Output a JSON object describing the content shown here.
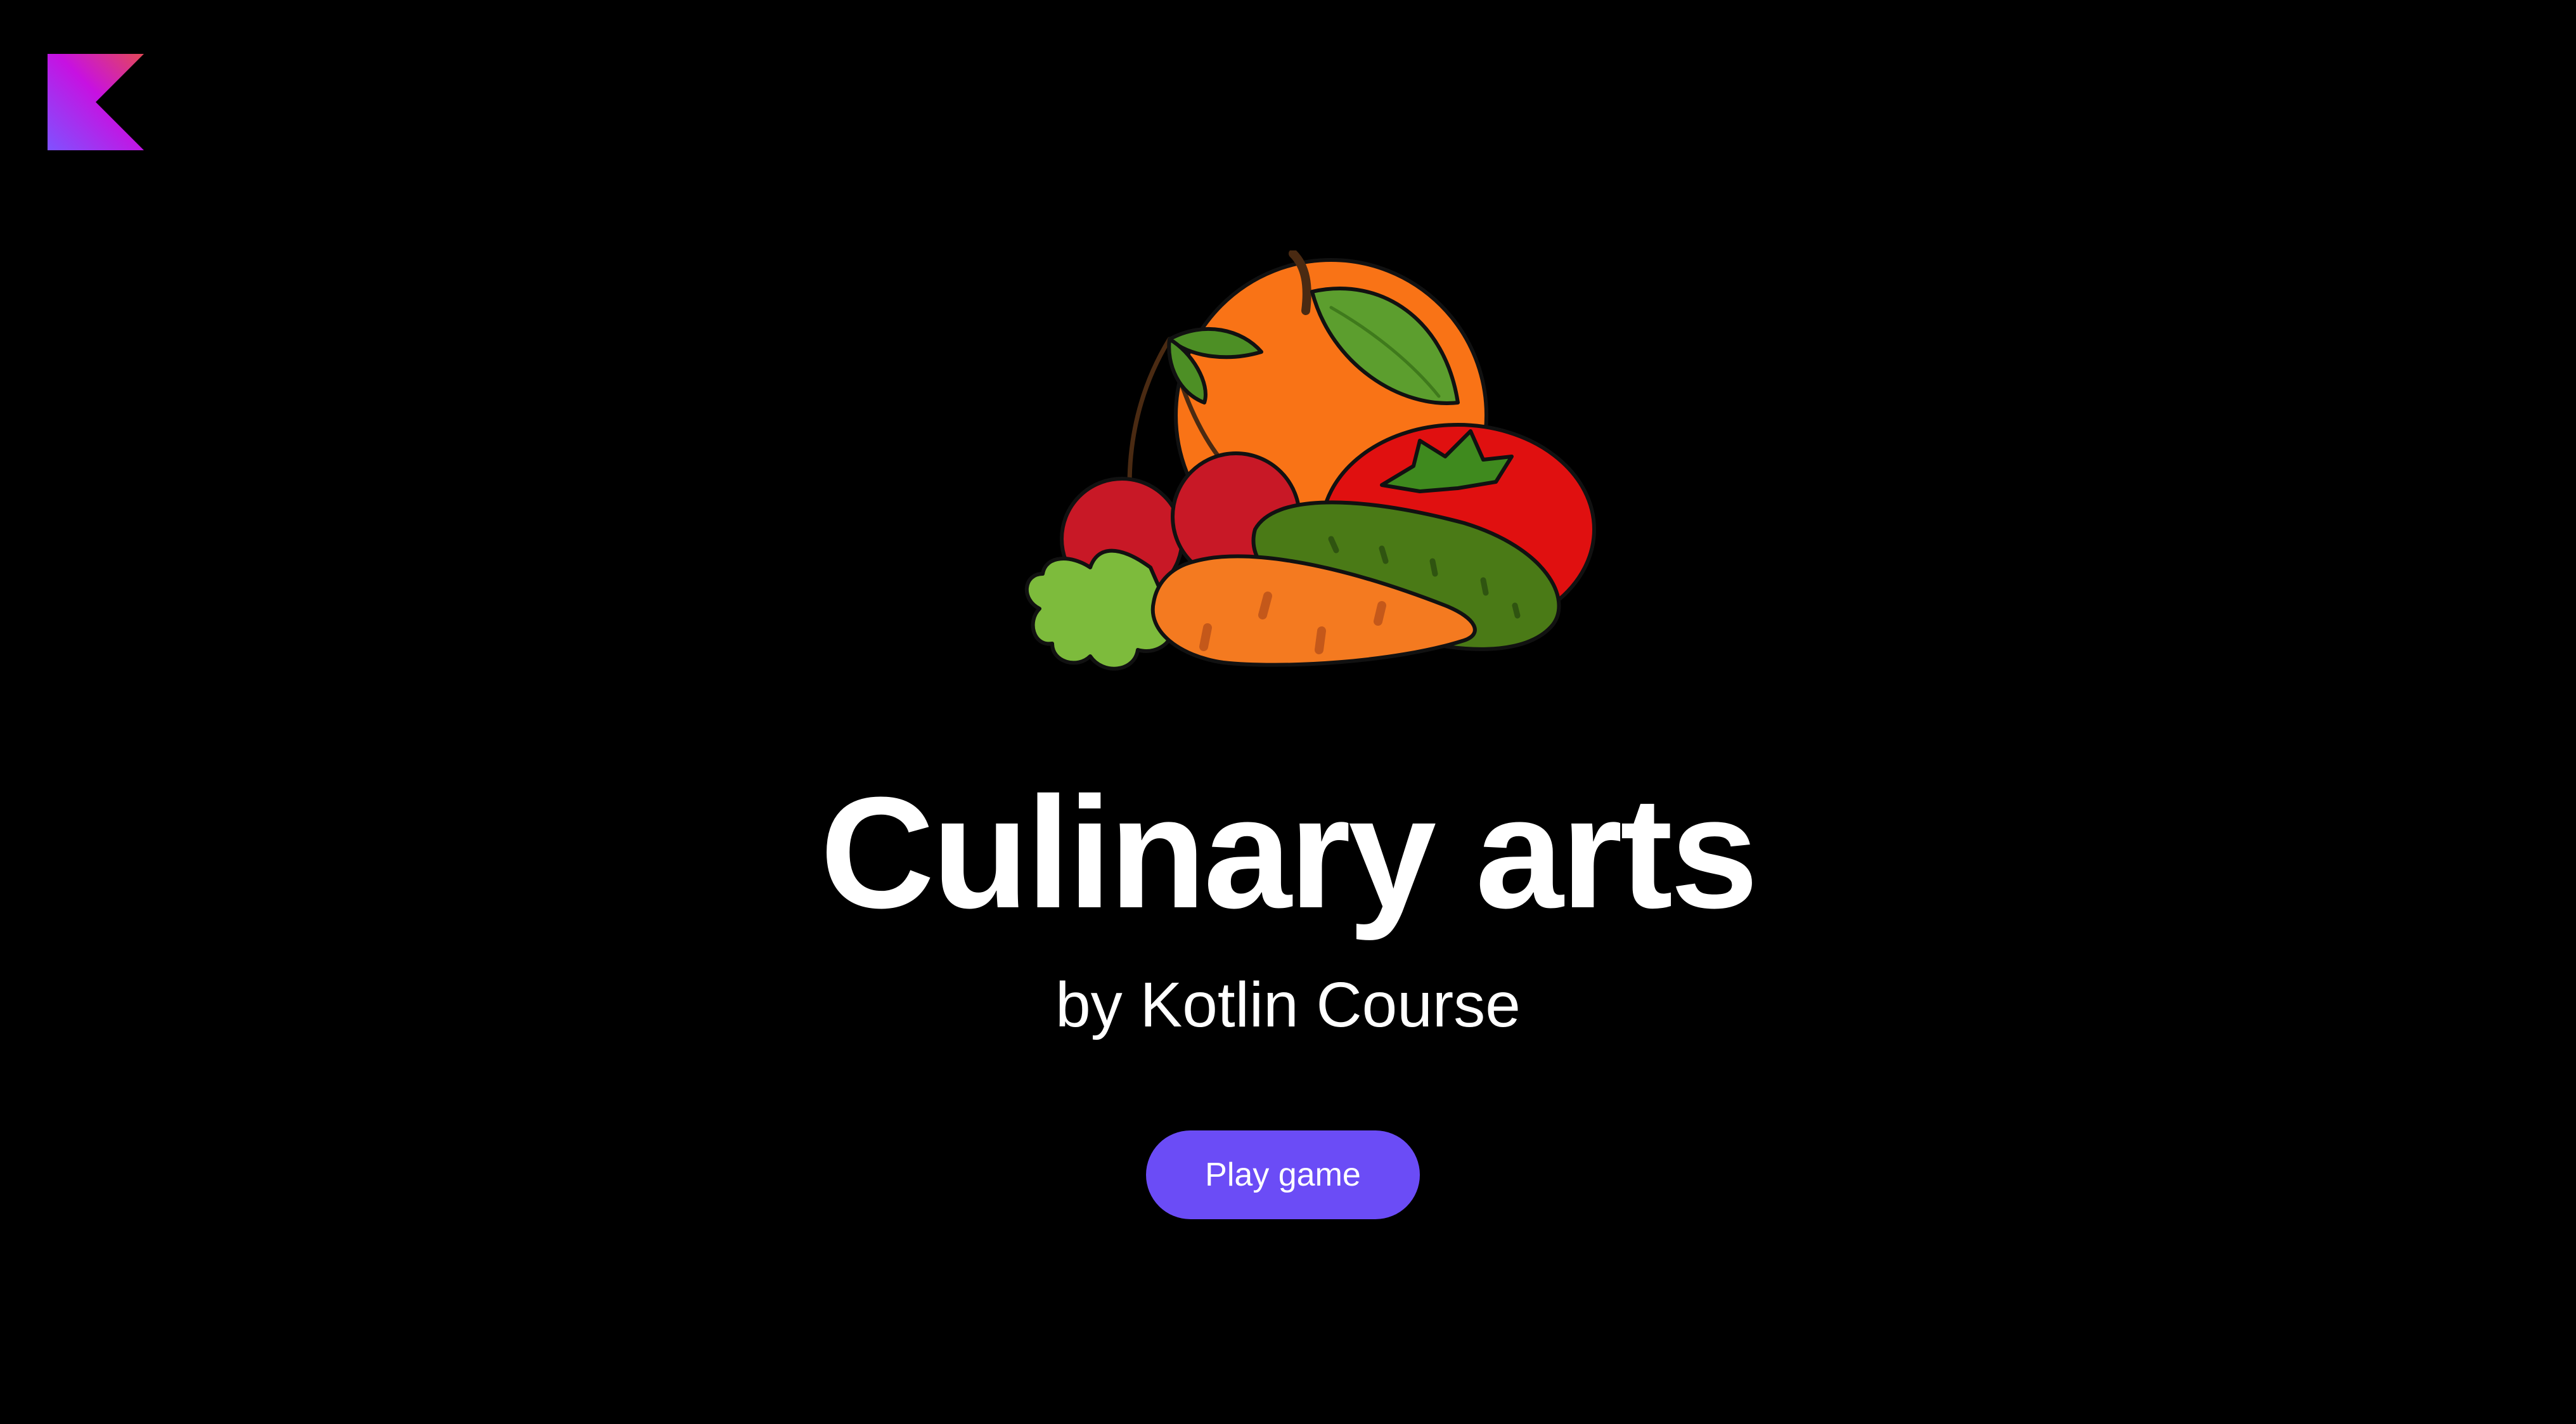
{
  "page": {
    "title": "Culinary arts",
    "subtitle": "by Kotlin Course",
    "background": "#000000"
  },
  "logo": {
    "icon": "kotlin-logo-icon",
    "gradient": [
      "#7f52ff",
      "#c711e1",
      "#e44857"
    ]
  },
  "illustration": {
    "icon": "fruits-and-vegetables-illustration"
  },
  "actions": {
    "play_label": "Play game",
    "play_color": "#6b4cf6"
  }
}
